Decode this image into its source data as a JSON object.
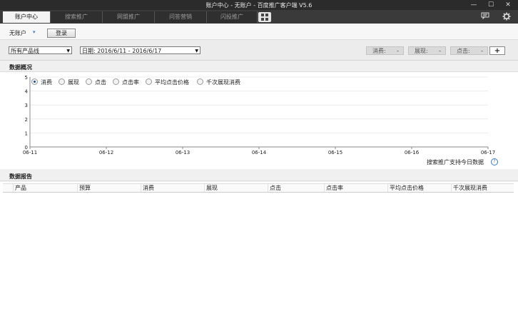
{
  "window": {
    "title": "账户中心 - 无账户 - 百度推广客户端 V5.6",
    "minimize_glyph": "—",
    "maximize_glyph": "☐",
    "close_glyph": "✕"
  },
  "tabs": [
    {
      "label": "账户中心",
      "active": true
    },
    {
      "label": "搜索推广",
      "active": false
    },
    {
      "label": "网盟推广",
      "active": false
    },
    {
      "label": "问答营销",
      "active": false
    },
    {
      "label": "闪投推广",
      "active": false
    }
  ],
  "tabbar_icons": [
    "grid-icon",
    "message-icon",
    "gear-icon"
  ],
  "account": {
    "label": "无账户",
    "caret": "▾",
    "login_label": "登录"
  },
  "filters": {
    "product_line": "所有产品线",
    "date_range": "日期: 2016/6/11 - 2016/6/17",
    "metric_buttons": [
      {
        "label": "消费:",
        "dash": "-"
      },
      {
        "label": "展现:",
        "dash": "-"
      },
      {
        "label": "点击:",
        "dash": "-"
      }
    ],
    "add_label": "+"
  },
  "overview": {
    "title": "数据概况",
    "legend": [
      {
        "label": "消费",
        "selected": true
      },
      {
        "label": "展现",
        "selected": false
      },
      {
        "label": "点击",
        "selected": false
      },
      {
        "label": "点击率",
        "selected": false
      },
      {
        "label": "平均点击价格",
        "selected": false
      },
      {
        "label": "千次展现消费",
        "selected": false
      }
    ],
    "note": "搜索推广支持今日数据",
    "help_glyph": "?"
  },
  "chart_data": {
    "type": "line",
    "x": [
      "06-11",
      "06-12",
      "06-13",
      "06-14",
      "06-15",
      "06-16",
      "06-17"
    ],
    "series": [],
    "ylim": [
      0,
      5
    ],
    "yticks": [
      0,
      1,
      2,
      3,
      4,
      5
    ],
    "grid": true,
    "title": "",
    "xlabel": "",
    "ylabel": ""
  },
  "report": {
    "title": "数据报告",
    "columns": [
      "产品",
      "预算",
      "消费",
      "展现",
      "点击",
      "点击率",
      "平均点击价格",
      "千次展现消费"
    ]
  }
}
